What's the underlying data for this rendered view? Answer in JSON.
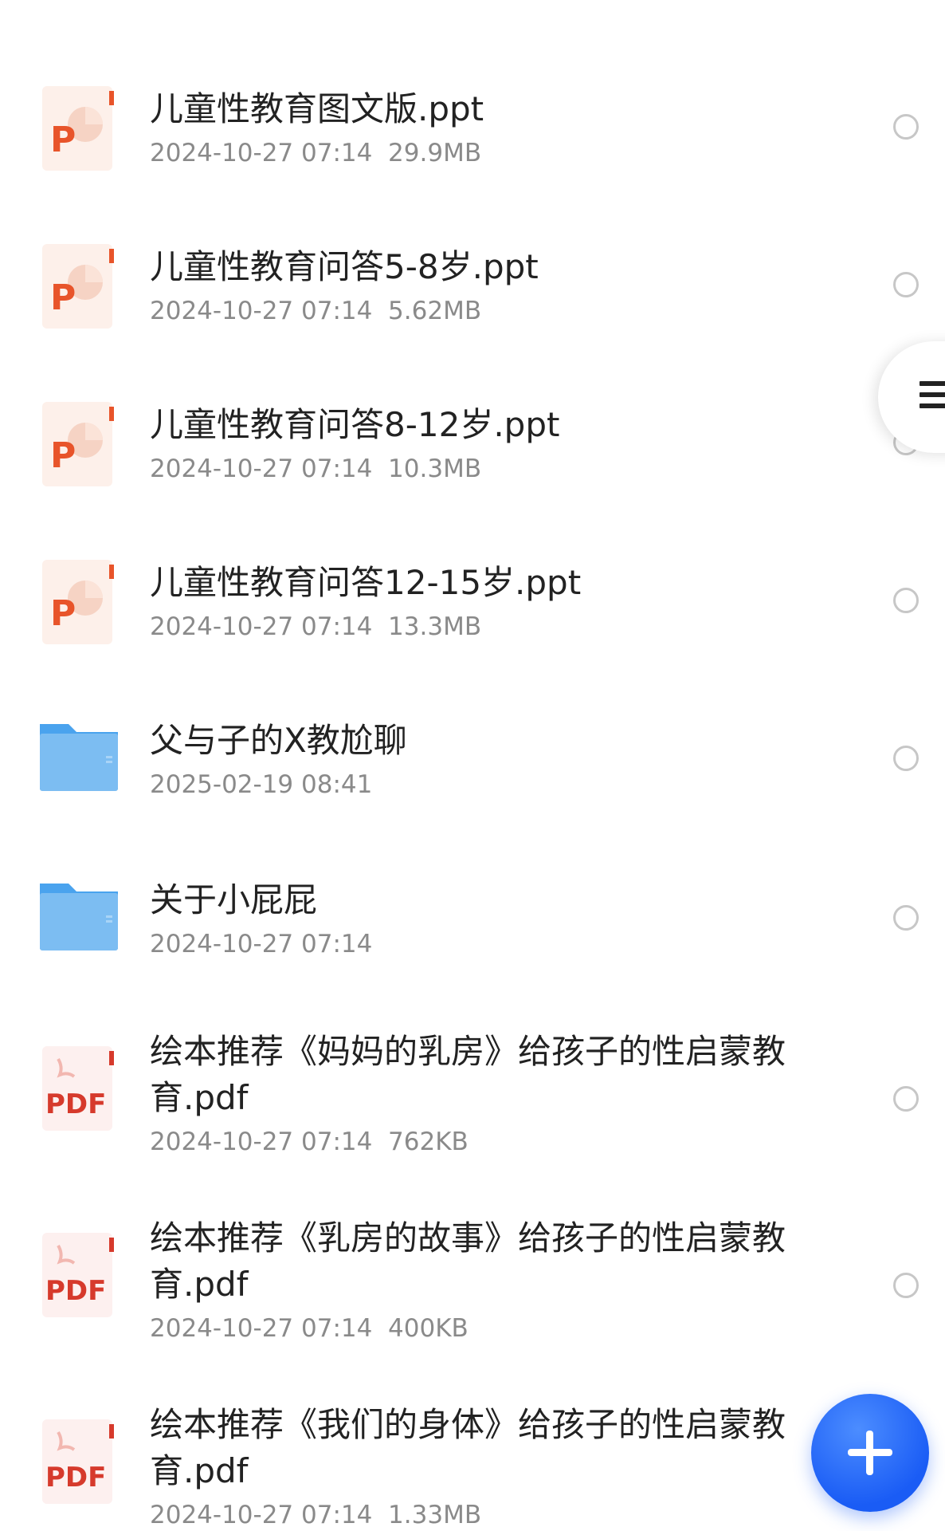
{
  "files": [
    {
      "type": "ppt",
      "name": "儿童性教育图文版.ppt",
      "meta": "2024-10-27 07:14  29.9MB",
      "icon": "ppt-file-icon",
      "icon_text": "P"
    },
    {
      "type": "ppt",
      "name": "儿童性教育问答5-8岁.ppt",
      "meta": "2024-10-27 07:14  5.62MB",
      "icon": "ppt-file-icon",
      "icon_text": "P"
    },
    {
      "type": "ppt",
      "name": "儿童性教育问答8-12岁.ppt",
      "meta": "2024-10-27 07:14  10.3MB",
      "icon": "ppt-file-icon",
      "icon_text": "P"
    },
    {
      "type": "ppt",
      "name": "儿童性教育问答12-15岁.ppt",
      "meta": "2024-10-27 07:14  13.3MB",
      "icon": "ppt-file-icon",
      "icon_text": "P"
    },
    {
      "type": "folder",
      "name": "父与子的X教尬聊",
      "meta": "2025-02-19 08:41",
      "icon": "folder-icon"
    },
    {
      "type": "folder",
      "name": "关于小屁屁",
      "meta": "2024-10-27 07:14",
      "icon": "folder-icon"
    },
    {
      "type": "pdf",
      "name": "绘本推荐《妈妈的乳房》给孩子的性启蒙教育.pdf",
      "meta": "2024-10-27 07:14  762KB",
      "icon": "pdf-file-icon",
      "icon_text": "PDF"
    },
    {
      "type": "pdf",
      "name": "绘本推荐《乳房的故事》给孩子的性启蒙教育.pdf",
      "meta": "2024-10-27 07:14  400KB",
      "icon": "pdf-file-icon",
      "icon_text": "PDF"
    },
    {
      "type": "pdf",
      "name": "绘本推荐《我们的身体》给孩子的性启蒙教育.pdf",
      "meta": "2024-10-27 07:14  1.33MB",
      "icon": "pdf-file-icon",
      "icon_text": "PDF"
    }
  ],
  "controls": {
    "side_menu_icon": "menu-icon",
    "fab_icon": "plus-icon"
  },
  "colors": {
    "ppt_accent": "#e8542a",
    "pdf_accent": "#d63a2c",
    "folder": "#7cbdf2",
    "fab": "#1a5cf5",
    "meta_text": "#8a8a8a"
  }
}
